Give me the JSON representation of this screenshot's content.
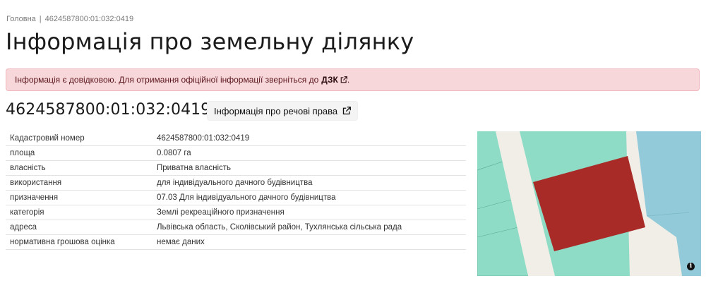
{
  "breadcrumb": {
    "home": "Головна",
    "separator": "|",
    "current": "4624587800:01:032:0419"
  },
  "page_title": "Інформація про земельну ділянку",
  "alert": {
    "text": "Інформація є довідковою. Для отримання офіційної інформації зверніться до",
    "link": "ДЗК",
    "suffix": "."
  },
  "cadastral_number": "4624587800:01:032:0419",
  "rights_button": "Інформація про речові права",
  "rows": [
    {
      "key": "Кадастровий номер",
      "value": "4624587800:01:032:0419"
    },
    {
      "key": "площа",
      "value": "0.0807 га"
    },
    {
      "key": "власність",
      "value": "Приватна власність"
    },
    {
      "key": "використання",
      "value": "для індивідуального дачного будівництва"
    },
    {
      "key": "призначення",
      "value": "07.03 Для індивідуального дачного будівництва"
    },
    {
      "key": "категорія",
      "value": "Землі рекреаційного призначення"
    },
    {
      "key": "адреса",
      "value": "Львівська область, Сколівський район, Тухлянська сільська рада"
    },
    {
      "key": "нормативна грошова оцінка",
      "value": "немає даних"
    }
  ],
  "map": {
    "info_glyph": "i",
    "parcel_color": "#a82b28",
    "zone_color": "#8edcc6",
    "water_color": "#93cad9",
    "road_color": "#f1eee8"
  }
}
